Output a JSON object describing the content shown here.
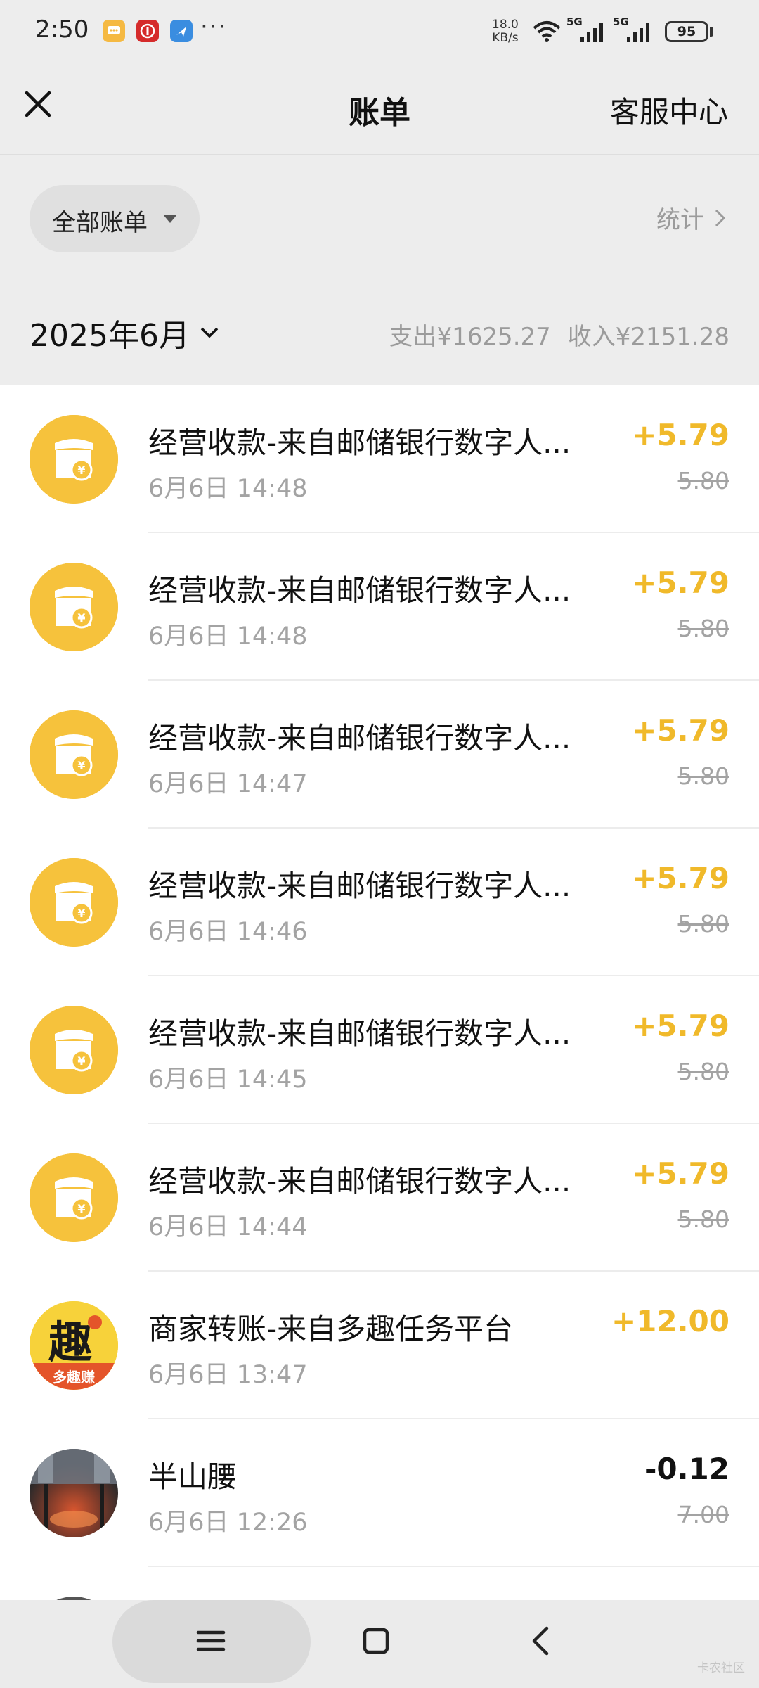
{
  "status_bar": {
    "time": "2:50",
    "dots": "···",
    "net_speed_value": "18.0",
    "net_speed_unit": "KB/s",
    "signal_1_label": "5G",
    "signal_2_label": "5G",
    "battery": "95"
  },
  "header": {
    "title": "账单",
    "right_label": "客服中心"
  },
  "filter": {
    "label": "全部账单",
    "stats_label": "统计"
  },
  "month": {
    "label": "2025年6月",
    "expense": "支出¥1625.27",
    "income": "收入¥2151.28"
  },
  "colors": {
    "accent_gold": "#f0b92a",
    "shop_icon": "#f6c23c"
  },
  "transactions": [
    {
      "title": "经营收款-来自邮储银行数字人...",
      "time": "6月6日 14:48",
      "amount": "+5.79",
      "original": "5.80",
      "icon": "shop-yuan-icon"
    },
    {
      "title": "经营收款-来自邮储银行数字人...",
      "time": "6月6日 14:48",
      "amount": "+5.79",
      "original": "5.80",
      "icon": "shop-yuan-icon"
    },
    {
      "title": "经营收款-来自邮储银行数字人...",
      "time": "6月6日 14:47",
      "amount": "+5.79",
      "original": "5.80",
      "icon": "shop-yuan-icon"
    },
    {
      "title": "经营收款-来自邮储银行数字人...",
      "time": "6月6日 14:46",
      "amount": "+5.79",
      "original": "5.80",
      "icon": "shop-yuan-icon"
    },
    {
      "title": "经营收款-来自邮储银行数字人...",
      "time": "6月6日 14:45",
      "amount": "+5.79",
      "original": "5.80",
      "icon": "shop-yuan-icon"
    },
    {
      "title": "经营收款-来自邮储银行数字人...",
      "time": "6月6日 14:44",
      "amount": "+5.79",
      "original": "5.80",
      "icon": "shop-yuan-icon"
    },
    {
      "title": "商家转账-来自多趣任务平台",
      "time": "6月6日 13:47",
      "amount": "+12.00",
      "original": "",
      "icon": "duoqu-logo",
      "logo_char": "趣",
      "logo_caption": "多趣赚"
    },
    {
      "title": "半山腰",
      "time": "6月6日 12:26",
      "amount": "-0.12",
      "original": "7.00",
      "icon": "user-photo-avatar"
    }
  ],
  "watermark": "卡农社区"
}
